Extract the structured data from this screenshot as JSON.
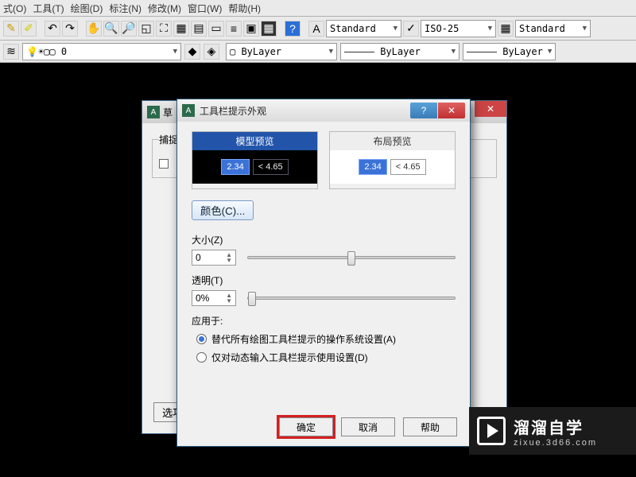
{
  "menubar": [
    "式(O)",
    "工具(T)",
    "绘图(D)",
    "标注(N)",
    "修改(M)",
    "窗口(W)",
    "帮助(H)"
  ],
  "tb_combos": {
    "style1": "Standard",
    "style2": "ISO-25",
    "style3": "Standard"
  },
  "props": {
    "layer": "0",
    "color": "ByLayer",
    "ltype": "ByLayer",
    "lweight": "ByLayer"
  },
  "under_dialog": {
    "title": "草",
    "tab": "捕捉",
    "options_btn": "选项"
  },
  "dialog": {
    "title": "工具栏提示外观",
    "help_btn": "?",
    "close_btn": "✕",
    "model_hdr": "模型预览",
    "layout_hdr": "布局预览",
    "dim1": "2.34",
    "dim2": "< 4.65",
    "color_btn": "颜色(C)...",
    "size_label": "大小(Z)",
    "size_value": "0",
    "trans_label": "透明(T)",
    "trans_value": "0%",
    "apply_label": "应用于:",
    "radio1": "替代所有绘图工具栏提示的操作系统设置(A)",
    "radio2": "仅对动态输入工具栏提示使用设置(D)",
    "ok": "确定",
    "cancel": "取消",
    "help": "帮助"
  },
  "watermark": {
    "name": "溜溜自学",
    "url": "zixue.3d66.com"
  }
}
